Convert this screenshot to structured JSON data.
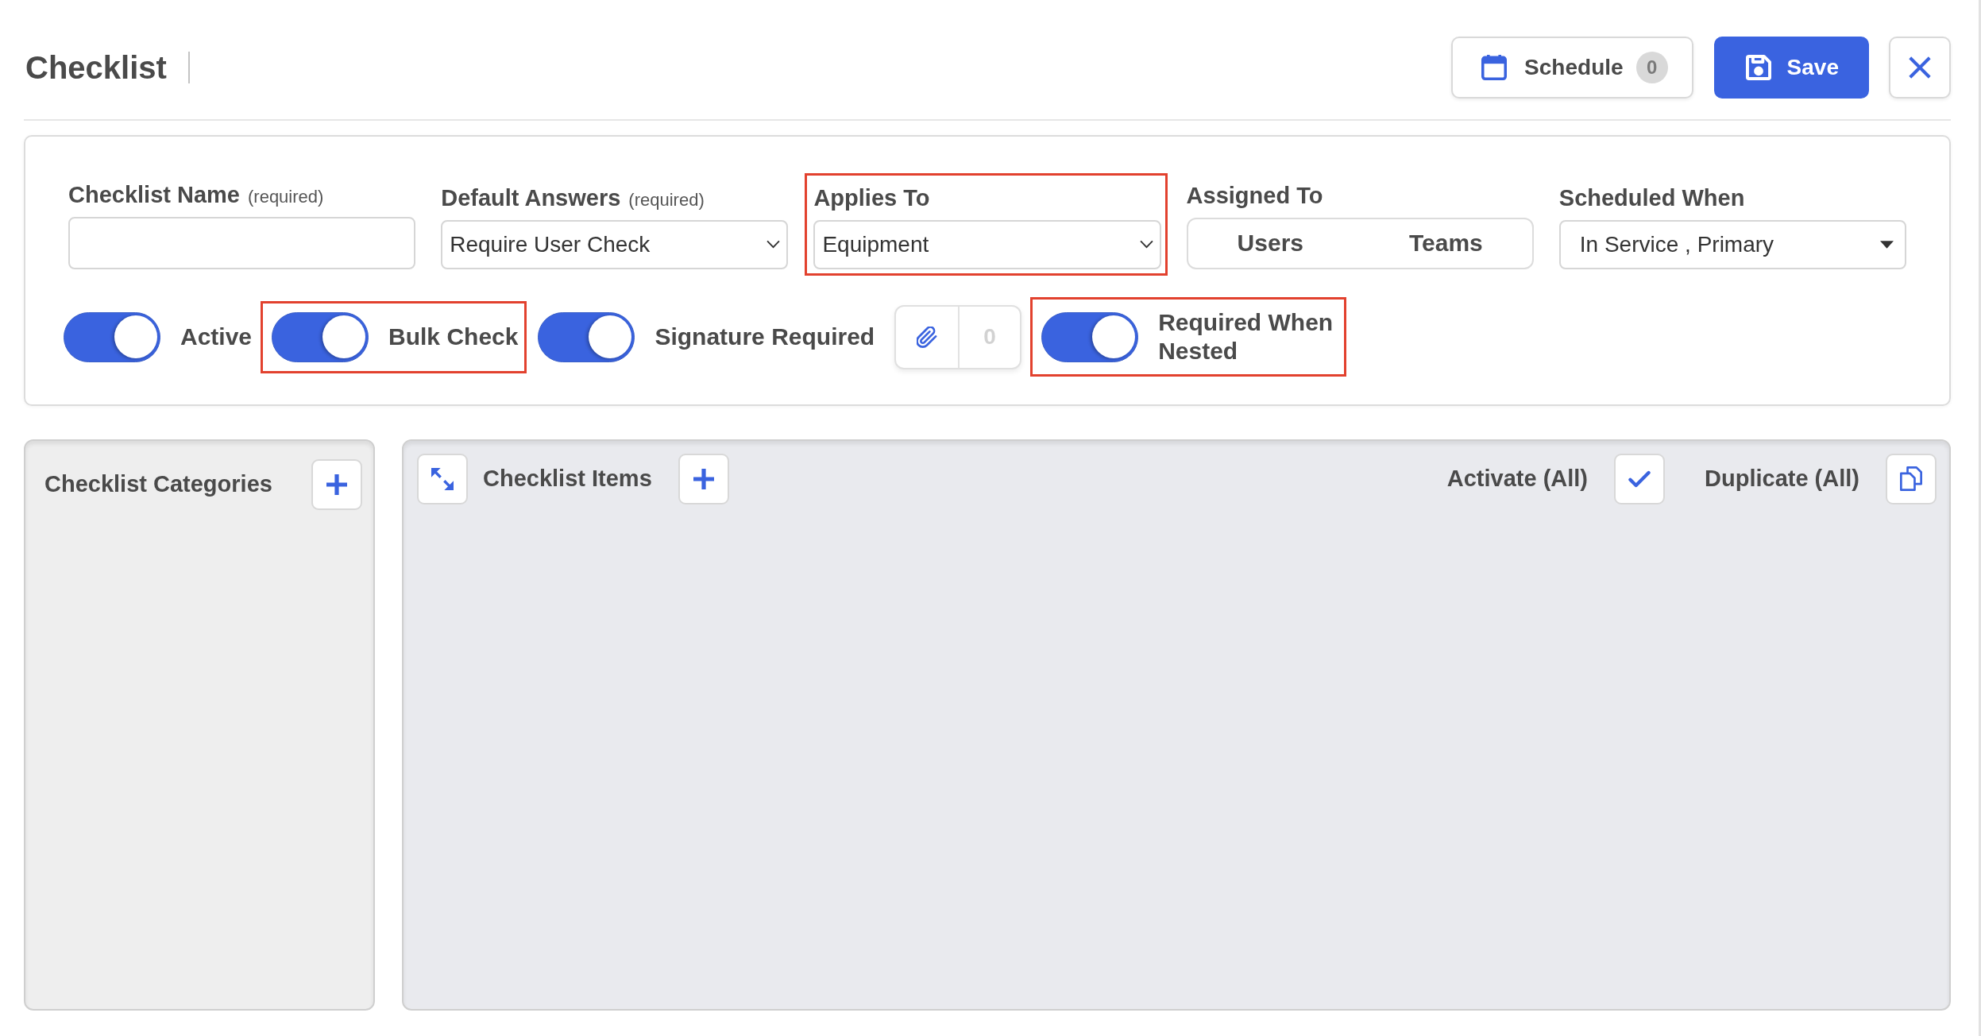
{
  "header": {
    "title": "Checklist",
    "buttons": [
      {
        "kind": "schedule",
        "label": "Schedule",
        "badge": "0"
      },
      {
        "kind": "save",
        "label": "Save"
      },
      {
        "kind": "close"
      }
    ]
  },
  "form": {
    "fields": [
      {
        "kind": "text",
        "label": "Checklist Name",
        "hint": "(required)",
        "highlighted": false
      },
      {
        "kind": "select",
        "label": "Default Answers",
        "hint": "(required)",
        "value": "Require User Check",
        "highlighted": false
      },
      {
        "kind": "select",
        "label": "Applies To",
        "value": "Equipment",
        "highlighted": true
      },
      {
        "kind": "segmented",
        "label": "Assigned To",
        "options": [
          "Users",
          "Teams"
        ],
        "highlighted": false
      },
      {
        "kind": "dropdown",
        "label": "Scheduled When",
        "value": "In Service , Primary",
        "highlighted": false
      }
    ],
    "controls": [
      {
        "kind": "toggle",
        "label": "Active",
        "on": true,
        "highlighted": false
      },
      {
        "kind": "toggle",
        "label": "Bulk Check",
        "on": true,
        "highlighted": true
      },
      {
        "kind": "toggle",
        "label": "Signature Required",
        "on": true,
        "highlighted": false
      },
      {
        "kind": "attachments",
        "count": "0",
        "highlighted": false
      },
      {
        "kind": "toggle",
        "label": "Required When Nested",
        "on": true,
        "highlighted": true
      }
    ]
  },
  "categories_panel": {
    "title": "Checklist Categories"
  },
  "items_panel": {
    "title": "Checklist Items",
    "actions": [
      {
        "kind": "activate",
        "label": "Activate (All)"
      },
      {
        "kind": "duplicate",
        "label": "Duplicate (All)"
      }
    ]
  }
}
